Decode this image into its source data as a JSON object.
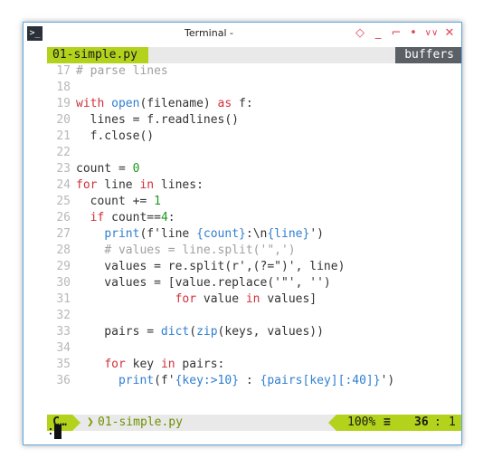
{
  "window": {
    "title": "Terminal -",
    "terminal_icon": "terminal-icon",
    "controls": [
      "diamond-icon",
      "minimize-icon",
      "maximize-icon",
      "dot-icon",
      "chevrons-down-icon",
      "close-icon"
    ],
    "controls_glyphs": [
      "◇",
      "_",
      "⌐",
      "•",
      "∨∨",
      "✕"
    ],
    "accent_color": "#e0475a"
  },
  "tabline": {
    "active_tab": "01-simple.py",
    "buffers_label": "buffers"
  },
  "editor": {
    "lines": [
      {
        "n": "17",
        "parts": [
          [
            "cm",
            "# parse lines"
          ]
        ]
      },
      {
        "n": "18",
        "parts": []
      },
      {
        "n": "19",
        "parts": [
          [
            "kw",
            "with "
          ],
          [
            "fn",
            "open"
          ],
          [
            "",
            "(filename) "
          ],
          [
            "kw",
            "as"
          ],
          [
            "",
            " f:"
          ]
        ]
      },
      {
        "n": "20",
        "parts": [
          [
            "",
            "  lines = f.readlines()"
          ]
        ]
      },
      {
        "n": "21",
        "parts": [
          [
            "",
            "  f.close()"
          ]
        ]
      },
      {
        "n": "22",
        "parts": []
      },
      {
        "n": "23",
        "parts": [
          [
            "",
            "count = "
          ],
          [
            "num",
            "0"
          ]
        ]
      },
      {
        "n": "24",
        "parts": [
          [
            "kw",
            "for"
          ],
          [
            "",
            " line "
          ],
          [
            "kw",
            "in"
          ],
          [
            "",
            " lines:"
          ]
        ]
      },
      {
        "n": "25",
        "parts": [
          [
            "",
            "  count += "
          ],
          [
            "num",
            "1"
          ]
        ]
      },
      {
        "n": "26",
        "parts": [
          [
            "",
            "  "
          ],
          [
            "kw",
            "if"
          ],
          [
            "",
            " count=="
          ],
          [
            "num",
            "4"
          ],
          [
            "",
            ":"
          ]
        ]
      },
      {
        "n": "27",
        "parts": [
          [
            "",
            "    "
          ],
          [
            "fn",
            "print"
          ],
          [
            "",
            "(f'line "
          ],
          [
            "fn",
            "{count}"
          ],
          [
            "",
            ":\\n"
          ],
          [
            "fn",
            "{line}"
          ],
          [
            "",
            "')"
          ]
        ]
      },
      {
        "n": "28",
        "parts": [
          [
            "",
            "    "
          ],
          [
            "cm",
            "# values = line.split('\",')"
          ]
        ]
      },
      {
        "n": "29",
        "parts": [
          [
            "",
            "    values = re.split(r',(?=\")', line)"
          ]
        ]
      },
      {
        "n": "30",
        "parts": [
          [
            "",
            "    values = [value.replace('\"', '')"
          ]
        ]
      },
      {
        "n": "31",
        "parts": [
          [
            "",
            "              "
          ],
          [
            "kw",
            "for"
          ],
          [
            "",
            " value "
          ],
          [
            "kw",
            "in"
          ],
          [
            "",
            " values]"
          ]
        ]
      },
      {
        "n": "32",
        "parts": []
      },
      {
        "n": "33",
        "parts": [
          [
            "",
            "    pairs = "
          ],
          [
            "fn",
            "dict"
          ],
          [
            "",
            "("
          ],
          [
            "fn",
            "zip"
          ],
          [
            "",
            "(keys, values))"
          ]
        ]
      },
      {
        "n": "34",
        "parts": []
      },
      {
        "n": "35",
        "parts": [
          [
            "",
            "    "
          ],
          [
            "kw",
            "for"
          ],
          [
            "",
            " key "
          ],
          [
            "kw",
            "in"
          ],
          [
            "",
            " pairs:"
          ]
        ]
      },
      {
        "n": "36",
        "parts": [
          [
            "",
            "      "
          ],
          [
            "fn",
            "print"
          ],
          [
            "",
            "(f'"
          ],
          [
            "fn",
            "{key:>10}"
          ],
          [
            "",
            " : "
          ],
          [
            "fn",
            "{pairs[key][:40]}"
          ],
          [
            "",
            "')"
          ]
        ]
      }
    ]
  },
  "statusbar": {
    "mode": "C…",
    "separator": "❯",
    "filename": "01-simple.py",
    "percent": "100%",
    "lines_icon": "≡",
    "row": "36",
    "colon": ":",
    "col": "1"
  },
  "cmdline": {
    "prompt": ":"
  }
}
